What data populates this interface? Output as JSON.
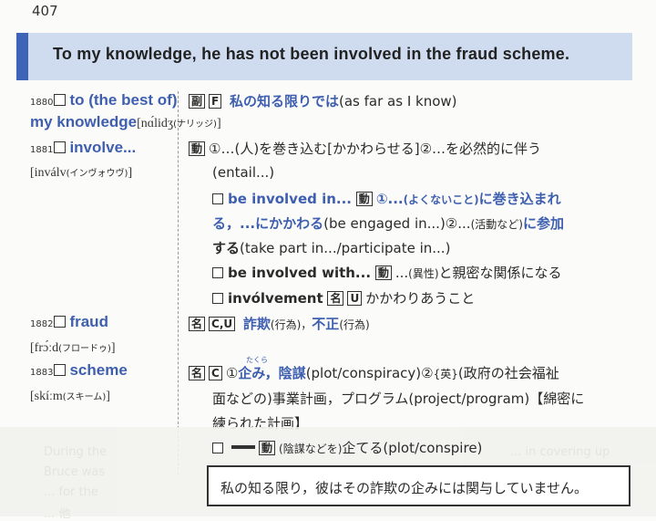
{
  "page_number": "407",
  "sentence": "To my knowledge, he has not been involved in the fraud scheme.",
  "translation": "私の知る限り，彼はその詐欺の企みには関与していません。",
  "faded_text": [
    "During the",
    "... in covering up",
    "Bruce was",
    "... for the",
    "... 他"
  ],
  "entries": {
    "e1880": {
      "num": "1880",
      "hw1": "to (the best of)",
      "hw2": "my knowledge",
      "pron": "[nɑ́lidʒ",
      "kana": "(ナリッジ)",
      "pron_end": "]",
      "tag1": "副",
      "tag2": "F",
      "def_blue": "私の知る限りでは",
      "def_rest": "(as far as I know)"
    },
    "e1881": {
      "num": "1881",
      "hw": "involve...",
      "pron": "[inválv",
      "kana": "(インヴォウヴ)",
      "pron_end": "]",
      "tag1": "動",
      "l1a": "①…(人)を巻き込む[かかわらせる]②…を必然的に伴う",
      "l2": "(entail...)",
      "s1_head": "be involved in...",
      "s1_tag": "動",
      "s1_a": "①...",
      "s1_b": "(よくないこと)",
      "s1_c": "に巻き込まれ",
      "l4a": "る，...にかかわる",
      "l4b": "(be engaged in...)②...",
      "l4c": "(活動など)",
      "l4d": "に参加",
      "l5a": "する",
      "l5b": "(take part in.../participate in...)",
      "s2_head": "be involved with...",
      "s2_tag": "動",
      "s2_a": "...",
      "s2_b": "(異性)",
      "s2_c": "と親密な関係になる",
      "s3_head": "invólvement",
      "s3_tag1": "名",
      "s3_tag2": "U",
      "s3_def": "かかわりあうこと"
    },
    "e1882": {
      "num": "1882",
      "hw": "fraud",
      "pron": "[frɔ́ːd",
      "kana": "(フロードゥ)",
      "pron_end": "]",
      "tag1": "名",
      "tag2": "C,U",
      "def_a": "詐欺",
      "def_b": "(行為)，",
      "def_c": "不正",
      "def_d": "(行為)"
    },
    "e1883": {
      "num": "1883",
      "hw": "scheme",
      "pron": "[skíːm",
      "kana": "(スキーム)",
      "pron_end": "]",
      "tag1": "名",
      "tag2": "C",
      "ruby": "たくら",
      "l1a": "①",
      "l1b": "企み，陰謀",
      "l1c": "(plot/conspiracy)②",
      "l1d": "{英}",
      "l1e": "(政府の社会福祉",
      "l2": "面などの)事業計画，プログラム(project/program)【綿密に",
      "l3": "練られた計画】",
      "s1_tag": "動",
      "s1_a": "(陰謀などを)",
      "s1_b": "企てる(plot/conspire)"
    }
  }
}
